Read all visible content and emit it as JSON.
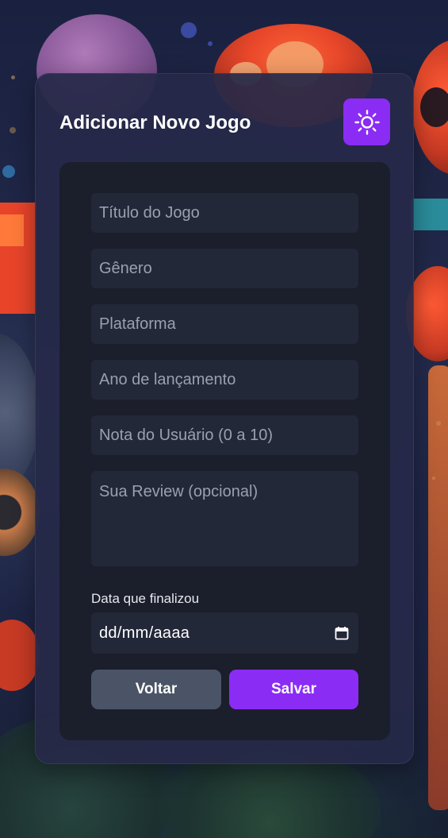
{
  "form": {
    "title": "Adicionar Novo Jogo",
    "theme_toggle_icon": "sun-icon",
    "fields": {
      "title_placeholder": "Título do Jogo",
      "genre_placeholder": "Gênero",
      "platform_placeholder": "Plataforma",
      "year_placeholder": "Ano de lançamento",
      "rating_placeholder": "Nota do Usuário (0 a 10)",
      "review_placeholder": "Sua Review (opcional)"
    },
    "date": {
      "label": "Data que finalizou",
      "placeholder": "dd/mm/aaaa",
      "icon": "calendar-icon"
    },
    "buttons": {
      "back_label": "Voltar",
      "save_label": "Salvar"
    }
  },
  "colors": {
    "accent": "#8b2cf5",
    "secondary_button": "#4b5466",
    "card_background": "#262948",
    "panel_background": "#1b1e2b",
    "input_background": "#222838"
  }
}
